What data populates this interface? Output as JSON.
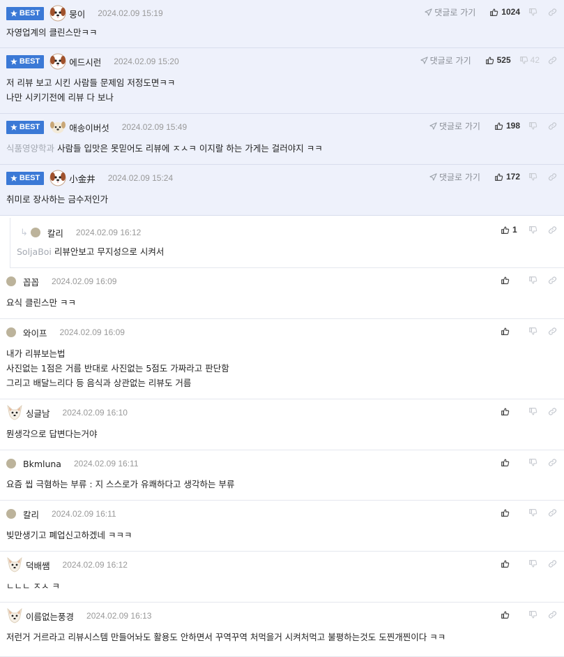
{
  "labels": {
    "best": "BEST",
    "goto": "댓글로 가기"
  },
  "colors": {
    "best_bg": "#eef1fb",
    "badge": "#3b79d6",
    "timestamp": "#999999",
    "tag": "#a4a9b2"
  },
  "comments": [
    {
      "best": true,
      "avatar": "dog-icon",
      "nick": "뭉이",
      "time": "2024.02.09 15:19",
      "goto": true,
      "likes": "1024",
      "dislikes": "",
      "lines": [
        "자영업계의 클린스만ㅋㅋ"
      ]
    },
    {
      "best": true,
      "avatar": "dog-icon",
      "nick": "에드시런",
      "time": "2024.02.09 15:20",
      "goto": true,
      "likes": "525",
      "dislikes": "42",
      "lines": [
        "저 리뷰 보고 시킨 사람들 문제임 저정도면ㅋㅋ",
        "나만 시키기전에 리뷰 다 보나"
      ]
    },
    {
      "best": true,
      "avatar": "puppy-icon",
      "nick": "애송이버섯",
      "time": "2024.02.09 15:49",
      "goto": true,
      "likes": "198",
      "dislikes": "",
      "tag": "식품영양학과",
      "lines": [
        "사람들 입맛은 못믿어도 리뷰에 ㅈㅅㅋ 이지랄 하는 가게는 걸러야지 ㅋㅋ"
      ]
    },
    {
      "best": true,
      "avatar": "dog-icon",
      "nick": "小金井",
      "time": "2024.02.09 15:24",
      "goto": true,
      "likes": "172",
      "dislikes": "",
      "lines": [
        "취미로 장사하는 금수저인가"
      ]
    },
    {
      "best": false,
      "reply": true,
      "avatar": "dot",
      "nick": "칼리",
      "time": "2024.02.09 16:12",
      "goto": false,
      "likes": "1",
      "dislikes": "",
      "tag": "SoljaBoi",
      "lines": [
        "리뷰안보고 무지성으로 시켜서"
      ]
    },
    {
      "best": false,
      "avatar": "dot",
      "nick": "꼽꼽",
      "time": "2024.02.09 16:09",
      "goto": false,
      "likes": "",
      "dislikes": "",
      "lines": [
        "요식 클린스만 ㅋㅋ"
      ]
    },
    {
      "best": false,
      "avatar": "dot",
      "nick": "와이프",
      "time": "2024.02.09 16:09",
      "goto": false,
      "likes": "",
      "dislikes": "",
      "lines": [
        "내가 리뷰보는법",
        "사진없는 1점은 거름 반대로 사진없는 5점도 가짜라고 판단함",
        "그리고 배달느리다 등 음식과 상관없는 리뷰도 거름"
      ]
    },
    {
      "best": false,
      "avatar": "fox-icon",
      "nick": "싱글남",
      "time": "2024.02.09 16:10",
      "goto": false,
      "likes": "",
      "dislikes": "",
      "lines": [
        "뭔생각으로 답변다는거야"
      ]
    },
    {
      "best": false,
      "avatar": "dot",
      "nick": "Bkmluna",
      "time": "2024.02.09 16:11",
      "goto": false,
      "likes": "",
      "dislikes": "",
      "lines": [
        "요즘 씹 극혐하는 부류 : 지 스스로가 유쾌하다고 생각하는 부류"
      ]
    },
    {
      "best": false,
      "avatar": "dot",
      "nick": "칼리",
      "time": "2024.02.09 16:11",
      "goto": false,
      "likes": "",
      "dislikes": "",
      "lines": [
        "빚만생기고 폐업신고하겠네 ㅋㅋㅋ"
      ]
    },
    {
      "best": false,
      "avatar": "fox-icon",
      "nick": "덕배쌤",
      "time": "2024.02.09 16:12",
      "goto": false,
      "likes": "",
      "dislikes": "",
      "lines": [
        "ㄴㄴㄴ ㅈㅅ ㅋ"
      ]
    },
    {
      "best": false,
      "avatar": "fox-icon",
      "nick": "이름없는풍경",
      "time": "2024.02.09 16:13",
      "goto": false,
      "likes": "",
      "dislikes": "",
      "lines": [
        "저런거 거르라고 리뷰시스템 만들어놔도 활용도 안하면서 꾸역꾸역 처먹을거 시켜처먹고 불평하는것도 도찐개찐이다 ㅋㅋ"
      ]
    }
  ]
}
